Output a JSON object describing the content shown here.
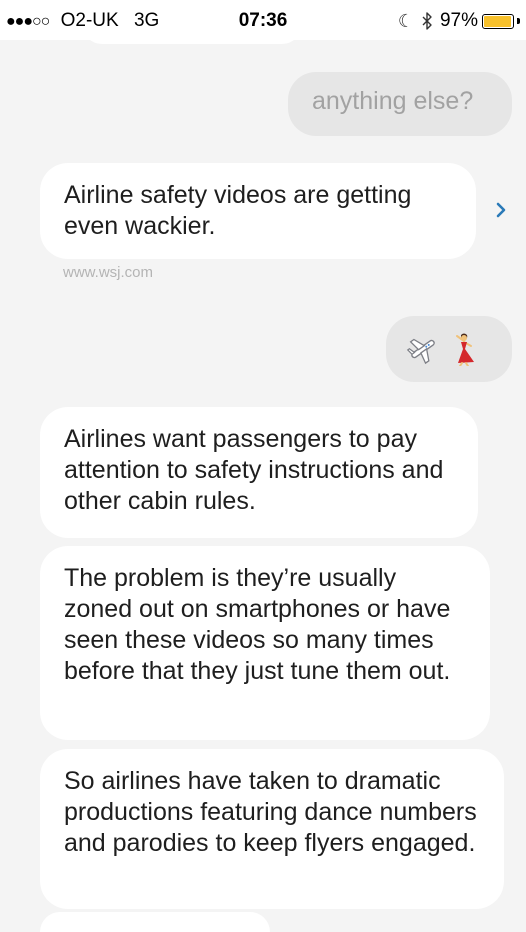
{
  "status_bar": {
    "signal": "●●●○○",
    "carrier": "O2-UK",
    "network": "3G",
    "time": "07:36",
    "battery_percent": "97%",
    "battery_level": 0.97,
    "battery_color": "#f8c12b"
  },
  "messages": {
    "outgoing_1": "anything else?",
    "incoming_1": "Airline safety videos are getting even wackier.",
    "incoming_1_source": "www.wsj.com",
    "outgoing_2_emoji": [
      "airplane-emoji",
      "dancer-emoji"
    ],
    "incoming_2": "Airlines want passengers to pay attention to safety instructions and other cabin rules.",
    "incoming_3": "The problem is they’re usually zoned out on smartphones or have seen these videos so many times before that they just tune them out.",
    "incoming_4": "So airlines have taken to dramatic productions featuring dance numbers and parodies to keep flyers engaged."
  },
  "colors": {
    "background": "#f4f4f4",
    "incoming_bubble": "#ffffff",
    "outgoing_bubble": "#e6e6e6",
    "link_chevron": "#2a7ab8"
  },
  "icons": [
    "moon-icon",
    "bluetooth-icon",
    "battery-icon",
    "chevron-right-icon"
  ]
}
